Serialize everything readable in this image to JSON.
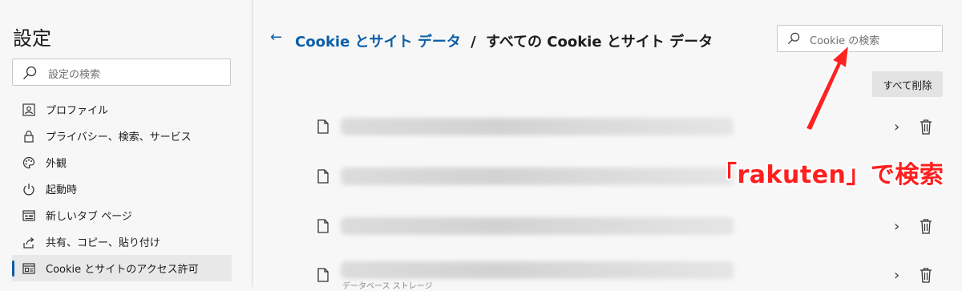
{
  "sidebar": {
    "title": "設定",
    "search_placeholder": "設定の検索",
    "items": [
      {
        "label": "プロファイル",
        "icon": "profile-icon"
      },
      {
        "label": "プライバシー、検索、サービス",
        "icon": "lock-icon"
      },
      {
        "label": "外観",
        "icon": "palette-icon"
      },
      {
        "label": "起動時",
        "icon": "power-icon"
      },
      {
        "label": "新しいタブ ページ",
        "icon": "new-tab-icon"
      },
      {
        "label": "共有、コピー、貼り付け",
        "icon": "share-icon"
      },
      {
        "label": "Cookie とサイトのアクセス許可",
        "icon": "cookie-settings-icon",
        "active": true
      }
    ]
  },
  "main": {
    "breadcrumb_link": "Cookie とサイト データ",
    "breadcrumb_sep": "/",
    "breadcrumb_current": "すべての Cookie とサイト データ",
    "search_placeholder": "Cookie の検索",
    "delete_all_label": "すべて削除",
    "rows_caption": "データベース ストレージ"
  },
  "annotation": {
    "text": "「rakuten」で検索",
    "color": "#ff1f1f"
  }
}
